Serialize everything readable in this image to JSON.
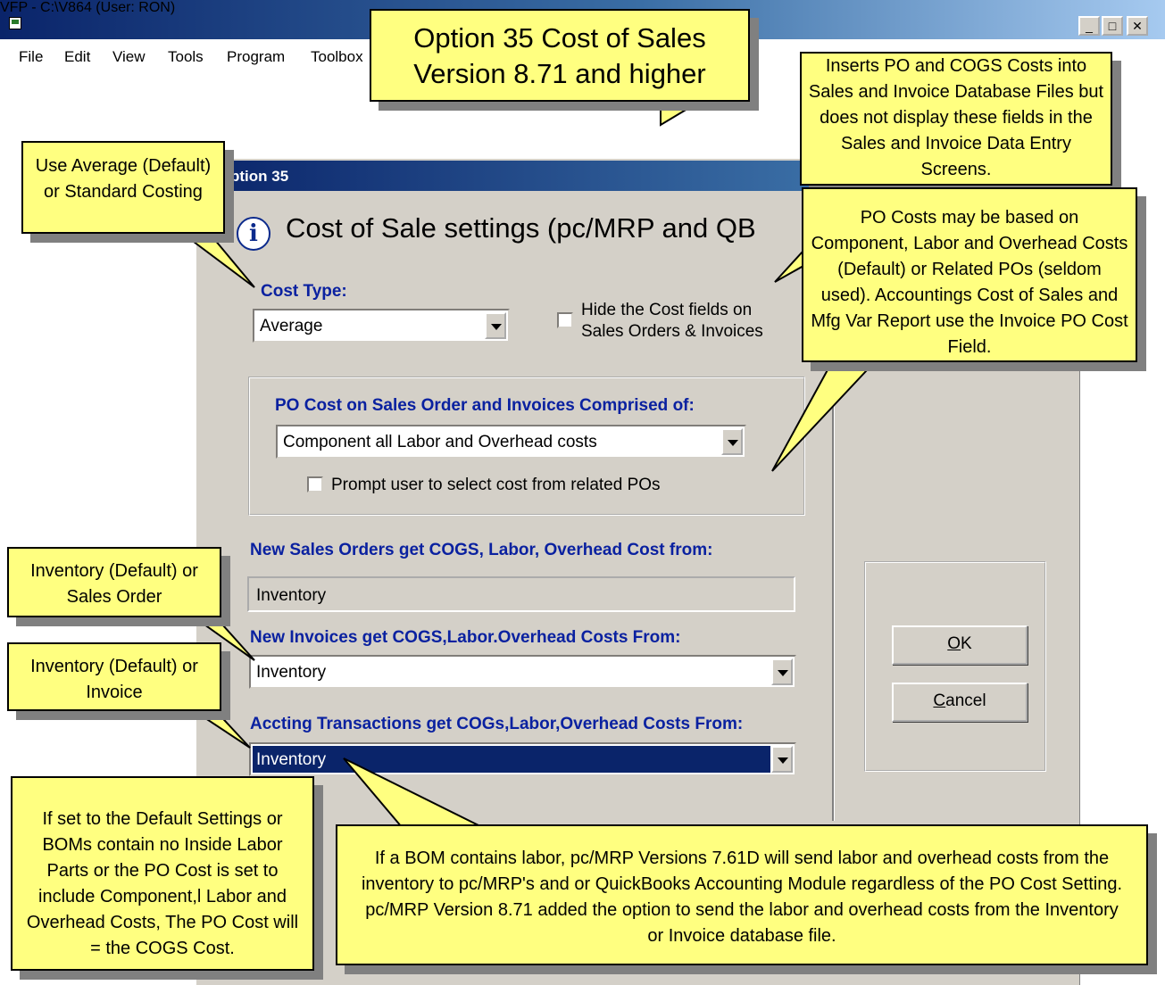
{
  "window": {
    "title": "VFP - C:\\V864  (User: RON)",
    "min_label": "_",
    "max_label": "□",
    "close_label": "✕"
  },
  "menu": [
    "File",
    "Edit",
    "View",
    "Tools",
    "Program",
    "Toolbox"
  ],
  "dialog": {
    "title": "ption 35",
    "heading": "Cost of Sale settings (pc/MRP and QB",
    "cost_type_label": "Cost Type:",
    "cost_type_value": "Average",
    "hide_cost_line1": "Hide the Cost fields on",
    "hide_cost_line2": "Sales Orders & Invoices",
    "po_cost_label": "PO Cost on Sales Order and Invoices Comprised of:",
    "po_cost_value": "Component all Labor and Overhead costs",
    "prompt_label": "Prompt user to select cost from related POs",
    "new_so_label": "New Sales Orders get COGS, Labor, Overhead Cost from:",
    "new_so_value": "Inventory",
    "new_inv_label": "New Invoices get  COGS,Labor.Overhead Costs From:",
    "new_inv_value": "Inventory",
    "accting_label": "Accting Transactions get COGs,Labor,Overhead Costs From:",
    "accting_value": "Inventory",
    "ok_mnemonic": "O",
    "ok_rest": "K",
    "cancel_mnemonic": "C",
    "cancel_rest": "ancel"
  },
  "callouts": {
    "title_line1": "Option 35 Cost of Sales",
    "title_line2": "Version 8.71 and higher",
    "inserts": "Inserts PO and COGS Costs into Sales and Invoice Database Files but does not display these fields in the Sales and Invoice Data Entry Screens.",
    "average": "Use Average (Default) or Standard Costing",
    "po_costs": "PO Costs may be based on Component, Labor and Overhead Costs (Default) or Related POs (seldom used).  Accountings Cost of Sales and Mfg Var Report use the Invoice PO Cost Field.",
    "inv_so": "Inventory (Default) or Sales Order",
    "inv_invoice": "Inventory (Default) or Invoice",
    "default_settings": "If set to the Default Settings or BOMs contain no Inside Labor Parts or the PO Cost is set to include Component,l Labor and Overhead Costs, The PO Cost will = the COGS Cost.",
    "bom_labor": "If a BOM contains labor, pc/MRP Versions 7.61D will send labor and overhead costs from the inventory to pc/MRP's and or QuickBooks Accounting Module regardless of  the PO Cost Setting. pc/MRP Version 8.71 added the option to send the labor and overhead costs from the Inventory or Invoice database file."
  },
  "colors": {
    "callout_fill": "#ffff80",
    "dialog_bg": "#d4d0c8",
    "label_blue": "#0a21a0",
    "titlebar": "#0a246a"
  }
}
